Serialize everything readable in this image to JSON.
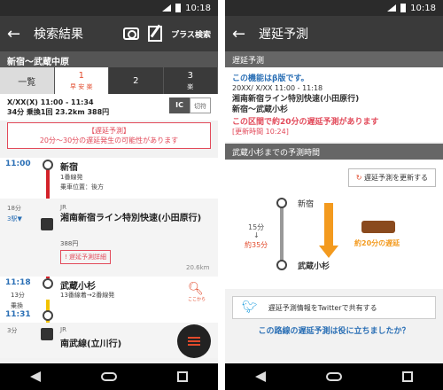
{
  "left": {
    "status_time": "10:18",
    "title": "検索結果",
    "plus_label": "プラス検索",
    "route": "新宿〜武蔵中原",
    "tabs": [
      {
        "label": "一覧",
        "sub": ""
      },
      {
        "label": "1",
        "sub": "早 安 楽"
      },
      {
        "label": "2",
        "sub": ""
      },
      {
        "label": "3",
        "sub": "楽"
      }
    ],
    "summary_line1": "X/XX(X) 11:00 - 11:34",
    "summary_line2": "34分 乗換1回 23.2km 388円",
    "ic_label": "IC",
    "ticket_label": "切符",
    "delay_title": "【遅延予測】",
    "delay_text": "20分〜30分の遅延発生の可能性があります",
    "stations": [
      {
        "time": "11:00",
        "name": "新宿",
        "track": "1番線発",
        "car": "乗車位置：後方"
      },
      {
        "time": "11:18",
        "name": "武蔵小杉",
        "track": "13番線着→2番線発",
        "arr": "11:31"
      }
    ],
    "seg1": {
      "mins": "18分",
      "stops": "3駅▼",
      "company": "JR",
      "line_name": "湘南新宿ライン特別快速(小田原行)",
      "fare": "388円",
      "detail": "遅延予測詳細",
      "km": "20.6km"
    },
    "transfer": {
      "mins": "13分",
      "label": "乗換"
    },
    "seg2": {
      "mins": "3分",
      "company": "JR",
      "line_name": "南武線(立川行)"
    },
    "search_caption": "ここから"
  },
  "right": {
    "status_time": "10:18",
    "title": "遅延予測",
    "section1": "遅延予測",
    "beta": "この機能はβ版です。",
    "info_line1": "20XX/ X/XX 11:00 - 11:18",
    "info_line2": "湘南新宿ライン特別快速(小田原行)",
    "info_line3": "新宿〜武蔵小杉",
    "warning": "この区間で約20分の遅延予測があります",
    "update_time": "[更新時間 10:24]",
    "section2": "武蔵小杉までの予測時間",
    "update_button": "遅延予測を更新する",
    "from_station": "新宿",
    "to_station": "武蔵小杉",
    "normal_time": "15分",
    "predicted_time": "約35分",
    "delay_label": "約20分の遅延",
    "share_label": "遅延予測情報をTwitterで共有する",
    "feedback": "この路線の遅延予測は役に立ちましたか？"
  }
}
